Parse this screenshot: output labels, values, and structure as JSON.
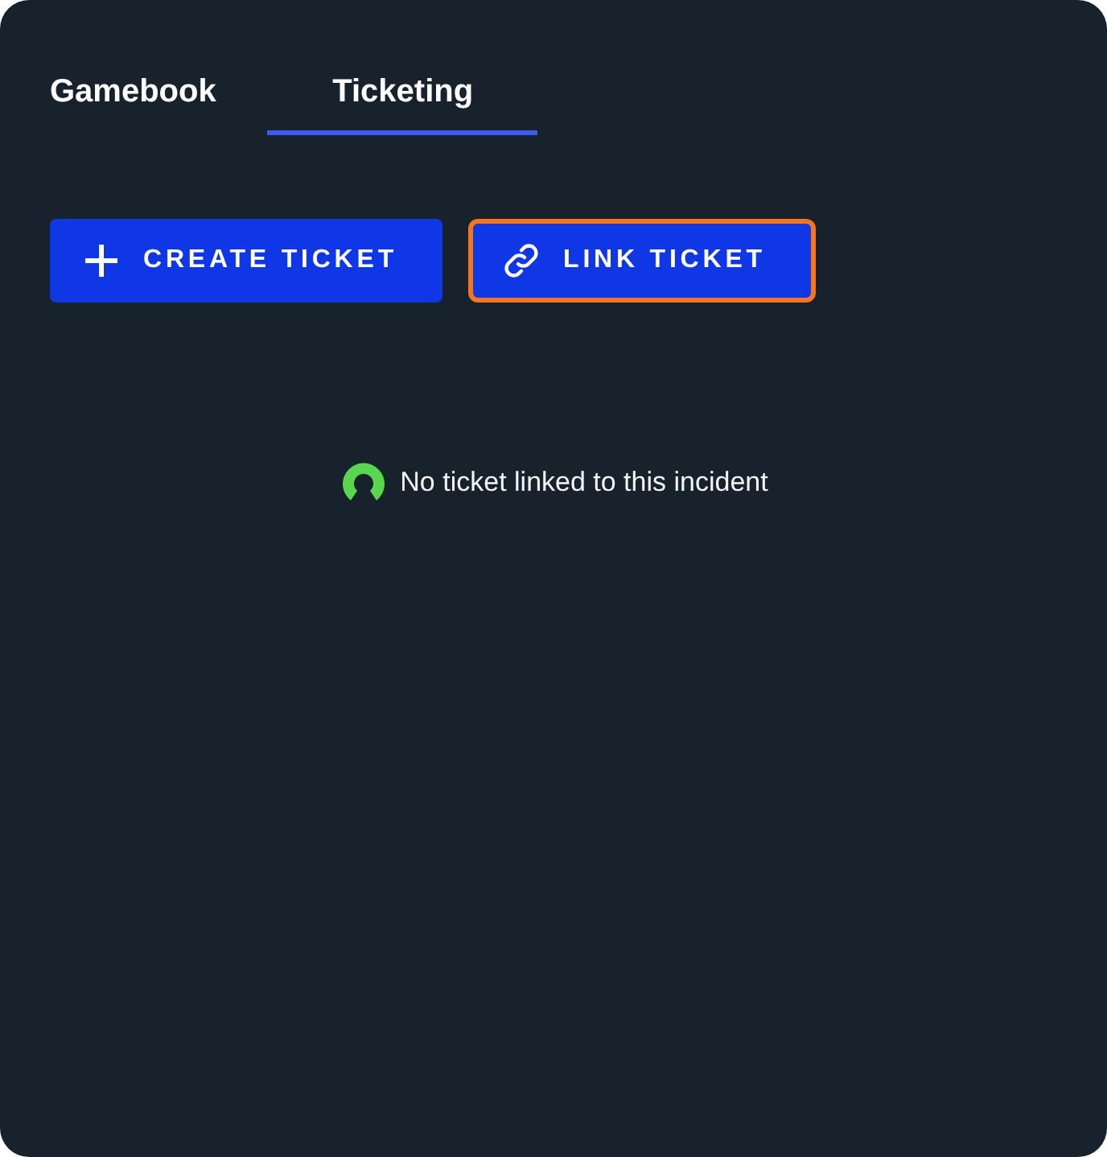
{
  "tabs": [
    {
      "label": "Gamebook",
      "selected": false
    },
    {
      "label": "Ticketing",
      "selected": true
    }
  ],
  "actions": [
    {
      "kind": "create",
      "label": "CREATE TICKET",
      "focused": false
    },
    {
      "kind": "link",
      "label": "LINK TICKET",
      "focused": true
    }
  ],
  "empty_state": {
    "message": "No ticket linked to this incident"
  }
}
